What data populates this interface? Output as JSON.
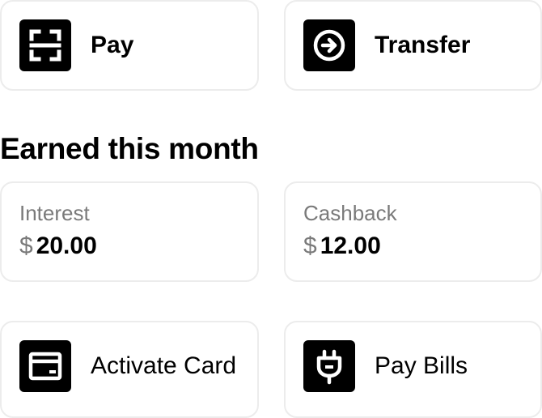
{
  "actions_top": [
    {
      "label": "Pay",
      "icon": "scan-icon"
    },
    {
      "label": "Transfer",
      "icon": "arrow-circle-right-icon"
    }
  ],
  "earned": {
    "title": "Earned this month",
    "items": [
      {
        "label": "Interest",
        "currency": "$",
        "amount": "20.00"
      },
      {
        "label": "Cashback",
        "currency": "$",
        "amount": "12.00"
      }
    ]
  },
  "actions_bottom": [
    {
      "label": "Activate Card",
      "icon": "card-icon"
    },
    {
      "label": "Pay Bills",
      "icon": "plug-icon"
    }
  ],
  "colors": {
    "border": "#ececec",
    "tile": "#000000",
    "muted_text": "#7a7a7a"
  }
}
